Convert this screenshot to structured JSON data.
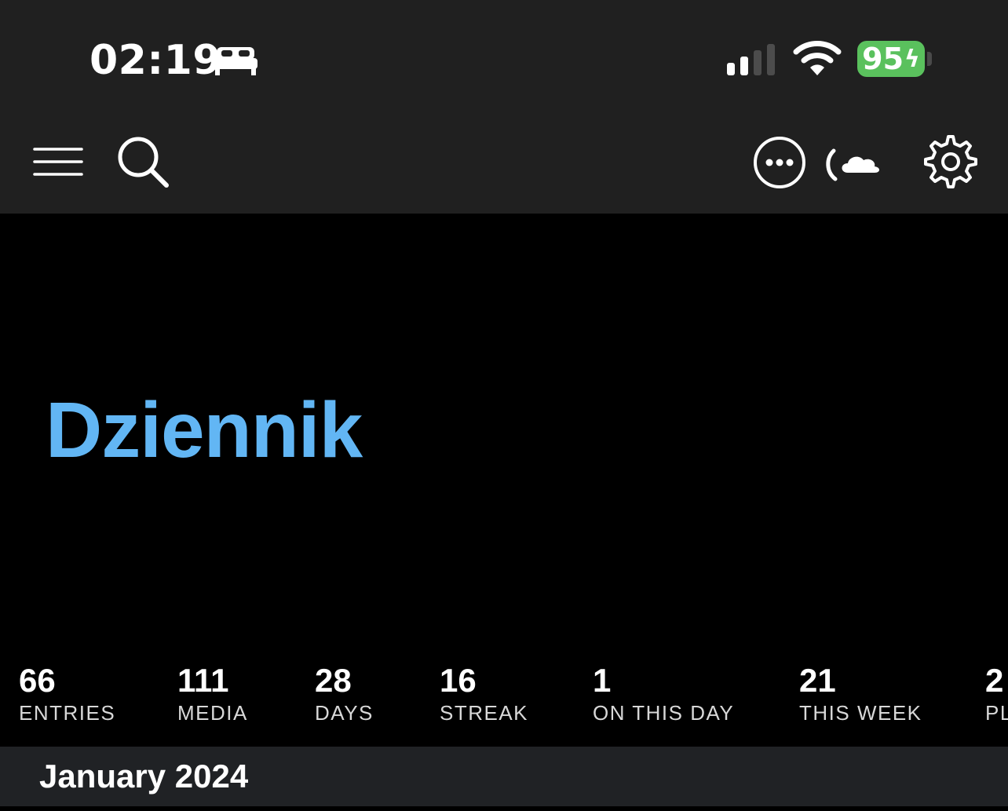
{
  "status_bar": {
    "time": "02:19",
    "bed_icon": "bed-icon",
    "signal_icon": "cellular-signal-icon",
    "wifi_icon": "wifi-icon",
    "battery_level": "95",
    "battery_charging_symbol": "ϟ",
    "battery_color": "#5ac15d"
  },
  "toolbar": {
    "menu_icon": "hamburger-menu-icon",
    "search_icon": "search-icon",
    "more_icon": "more-options-icon",
    "sync_icon": "cloud-sync-icon",
    "settings_icon": "gear-icon"
  },
  "journal": {
    "title": "Dziennik",
    "title_color": "#62b6f4"
  },
  "stats": [
    {
      "value": "66",
      "label": "ENTRIES"
    },
    {
      "value": "111",
      "label": "MEDIA"
    },
    {
      "value": "28",
      "label": "DAYS"
    },
    {
      "value": "16",
      "label": "STREAK"
    },
    {
      "value": "1",
      "label": "ON THIS DAY"
    },
    {
      "value": "21",
      "label": "THIS WEEK"
    },
    {
      "value": "2",
      "label": "PL"
    }
  ],
  "entries": {
    "month_header": "January 2024"
  }
}
